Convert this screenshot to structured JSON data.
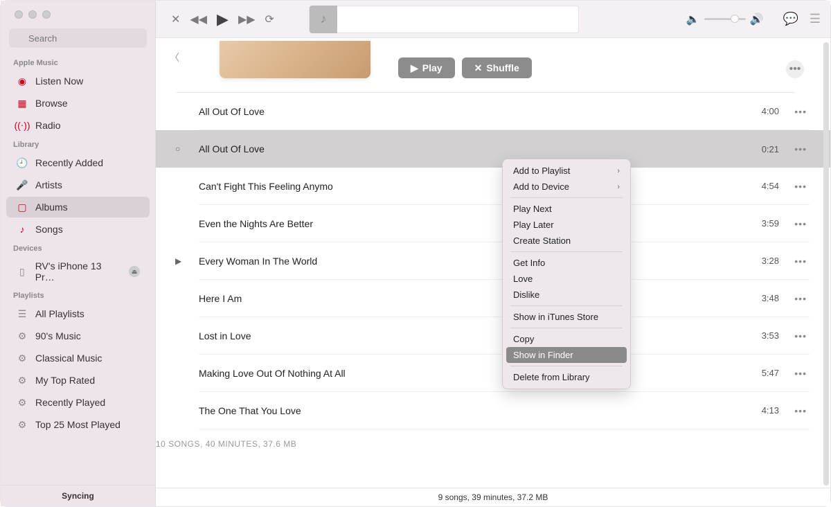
{
  "search": {
    "placeholder": "Search"
  },
  "sidebar": {
    "sections": {
      "apple_music": {
        "header": "Apple Music",
        "items": [
          {
            "label": "Listen Now",
            "icon": "▶"
          },
          {
            "label": "Browse",
            "icon": "▦"
          },
          {
            "label": "Radio",
            "icon": "📻"
          }
        ]
      },
      "library": {
        "header": "Library",
        "items": [
          {
            "label": "Recently Added",
            "icon": "🕘"
          },
          {
            "label": "Artists",
            "icon": "🎤"
          },
          {
            "label": "Albums",
            "icon": "💿",
            "selected": true
          },
          {
            "label": "Songs",
            "icon": "♪"
          }
        ]
      },
      "devices": {
        "header": "Devices",
        "items": [
          {
            "label": "RV's iPhone 13 Pr…",
            "icon": "📱"
          }
        ]
      },
      "playlists": {
        "header": "Playlists",
        "items": [
          {
            "label": "All Playlists",
            "icon": "☰"
          },
          {
            "label": "90's Music",
            "icon": "⚙"
          },
          {
            "label": "Classical Music",
            "icon": "⚙"
          },
          {
            "label": "My Top Rated",
            "icon": "⚙"
          },
          {
            "label": "Recently Played",
            "icon": "⚙"
          },
          {
            "label": "Top 25 Most Played",
            "icon": "⚙"
          }
        ]
      }
    },
    "bottom_status": "Syncing"
  },
  "header": {
    "play_label": "Play",
    "shuffle_label": "Shuffle"
  },
  "tracks": [
    {
      "title": "All Out Of Love",
      "time": "4:00"
    },
    {
      "title": "All Out Of Love",
      "time": "0:21",
      "selected": true
    },
    {
      "title": "Can't Fight This Feeling Anymo",
      "time": "4:54"
    },
    {
      "title": "Even the Nights Are Better",
      "time": "3:59"
    },
    {
      "title": "Every Woman In The World",
      "time": "3:28",
      "playing": true
    },
    {
      "title": "Here I Am",
      "time": "3:48"
    },
    {
      "title": "Lost in Love",
      "time": "3:53"
    },
    {
      "title": "Making Love Out Of Nothing At All",
      "time": "5:47"
    },
    {
      "title": "The One That You Love",
      "time": "4:13"
    }
  ],
  "summary": "10 SONGS, 40 MINUTES, 37.6 MB",
  "footer": "9 songs, 39 minutes, 37.2 MB",
  "context_menu": {
    "items": [
      {
        "label": "Add to Playlist",
        "submenu": true
      },
      {
        "label": "Add to Device",
        "submenu": true
      },
      {
        "sep": true
      },
      {
        "label": "Play Next"
      },
      {
        "label": "Play Later"
      },
      {
        "label": "Create Station"
      },
      {
        "sep": true
      },
      {
        "label": "Get Info"
      },
      {
        "label": "Love"
      },
      {
        "label": "Dislike"
      },
      {
        "sep": true
      },
      {
        "label": "Show in iTunes Store"
      },
      {
        "sep": true
      },
      {
        "label": "Copy"
      },
      {
        "label": "Show in Finder",
        "highlight": true
      },
      {
        "sep": true
      },
      {
        "label": "Delete from Library"
      }
    ]
  }
}
